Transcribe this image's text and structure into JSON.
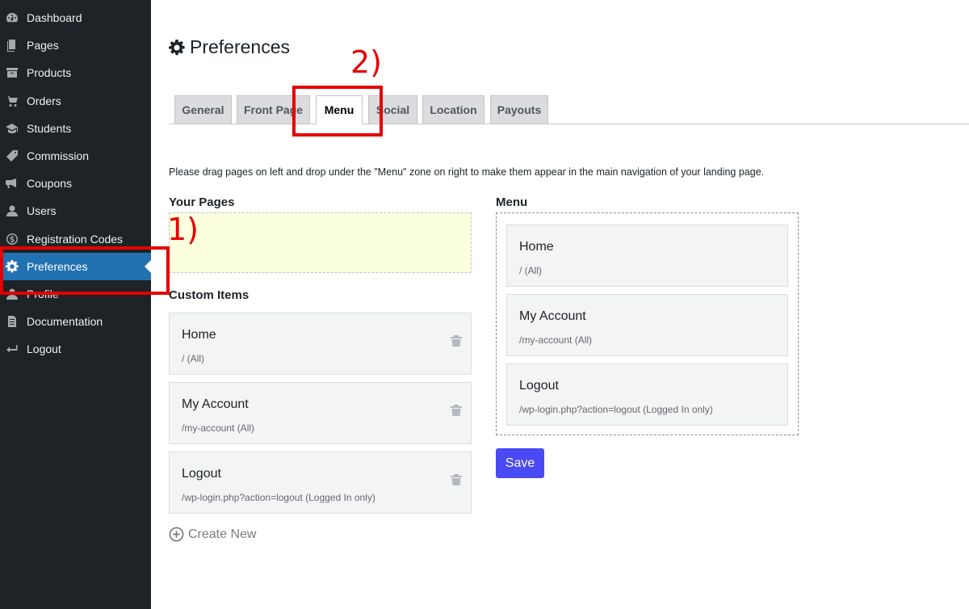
{
  "sidebar": {
    "items": [
      {
        "label": "Dashboard",
        "icon": "dashboard-icon"
      },
      {
        "label": "Pages",
        "icon": "pages-icon"
      },
      {
        "label": "Products",
        "icon": "products-icon"
      },
      {
        "label": "Orders",
        "icon": "cart-icon"
      },
      {
        "label": "Students",
        "icon": "graduation-cap-icon"
      },
      {
        "label": "Commission",
        "icon": "tag-icon"
      },
      {
        "label": "Coupons",
        "icon": "megaphone-icon"
      },
      {
        "label": "Users",
        "icon": "user-icon"
      },
      {
        "label": "Registration Codes",
        "icon": "dollar-circle-icon"
      },
      {
        "label": "Preferences",
        "icon": "gear-icon",
        "active": true
      },
      {
        "label": "Profile",
        "icon": "user-icon"
      },
      {
        "label": "Documentation",
        "icon": "document-icon"
      },
      {
        "label": "Logout",
        "icon": "logout-icon"
      }
    ]
  },
  "header": {
    "title": "Preferences",
    "icon": "gear-icon"
  },
  "tabs": [
    {
      "label": "General"
    },
    {
      "label": "Front Page"
    },
    {
      "label": "Menu",
      "active": true
    },
    {
      "label": "Social"
    },
    {
      "label": "Location"
    },
    {
      "label": "Payouts"
    }
  ],
  "description": "Please drag pages on left and drop under the \"Menu\" zone on right to make them appear in the main navigation of your landing page.",
  "your_pages": {
    "heading": "Your Pages"
  },
  "custom_items": {
    "heading": "Custom Items",
    "items": [
      {
        "title": "Home",
        "subtitle": "/ (All)"
      },
      {
        "title": "My Account",
        "subtitle": "/my-account (All)"
      },
      {
        "title": "Logout",
        "subtitle": "/wp-login.php?action=logout (Logged In only)"
      }
    ],
    "create_new_label": "Create New"
  },
  "menu": {
    "heading": "Menu",
    "items": [
      {
        "title": "Home",
        "subtitle": "/ (All)"
      },
      {
        "title": "My Account",
        "subtitle": "/my-account (All)"
      },
      {
        "title": "Logout",
        "subtitle": "/wp-login.php?action=logout (Logged In only)"
      }
    ]
  },
  "save_label": "Save",
  "annotations": {
    "one": "1)",
    "two": "2)",
    "color": "#e60000"
  },
  "colors": {
    "sidebar_bg": "#1d2327",
    "active_bg": "#2271b1",
    "save_btn": "#4a4af4",
    "drop_zone": "#fbffde"
  }
}
